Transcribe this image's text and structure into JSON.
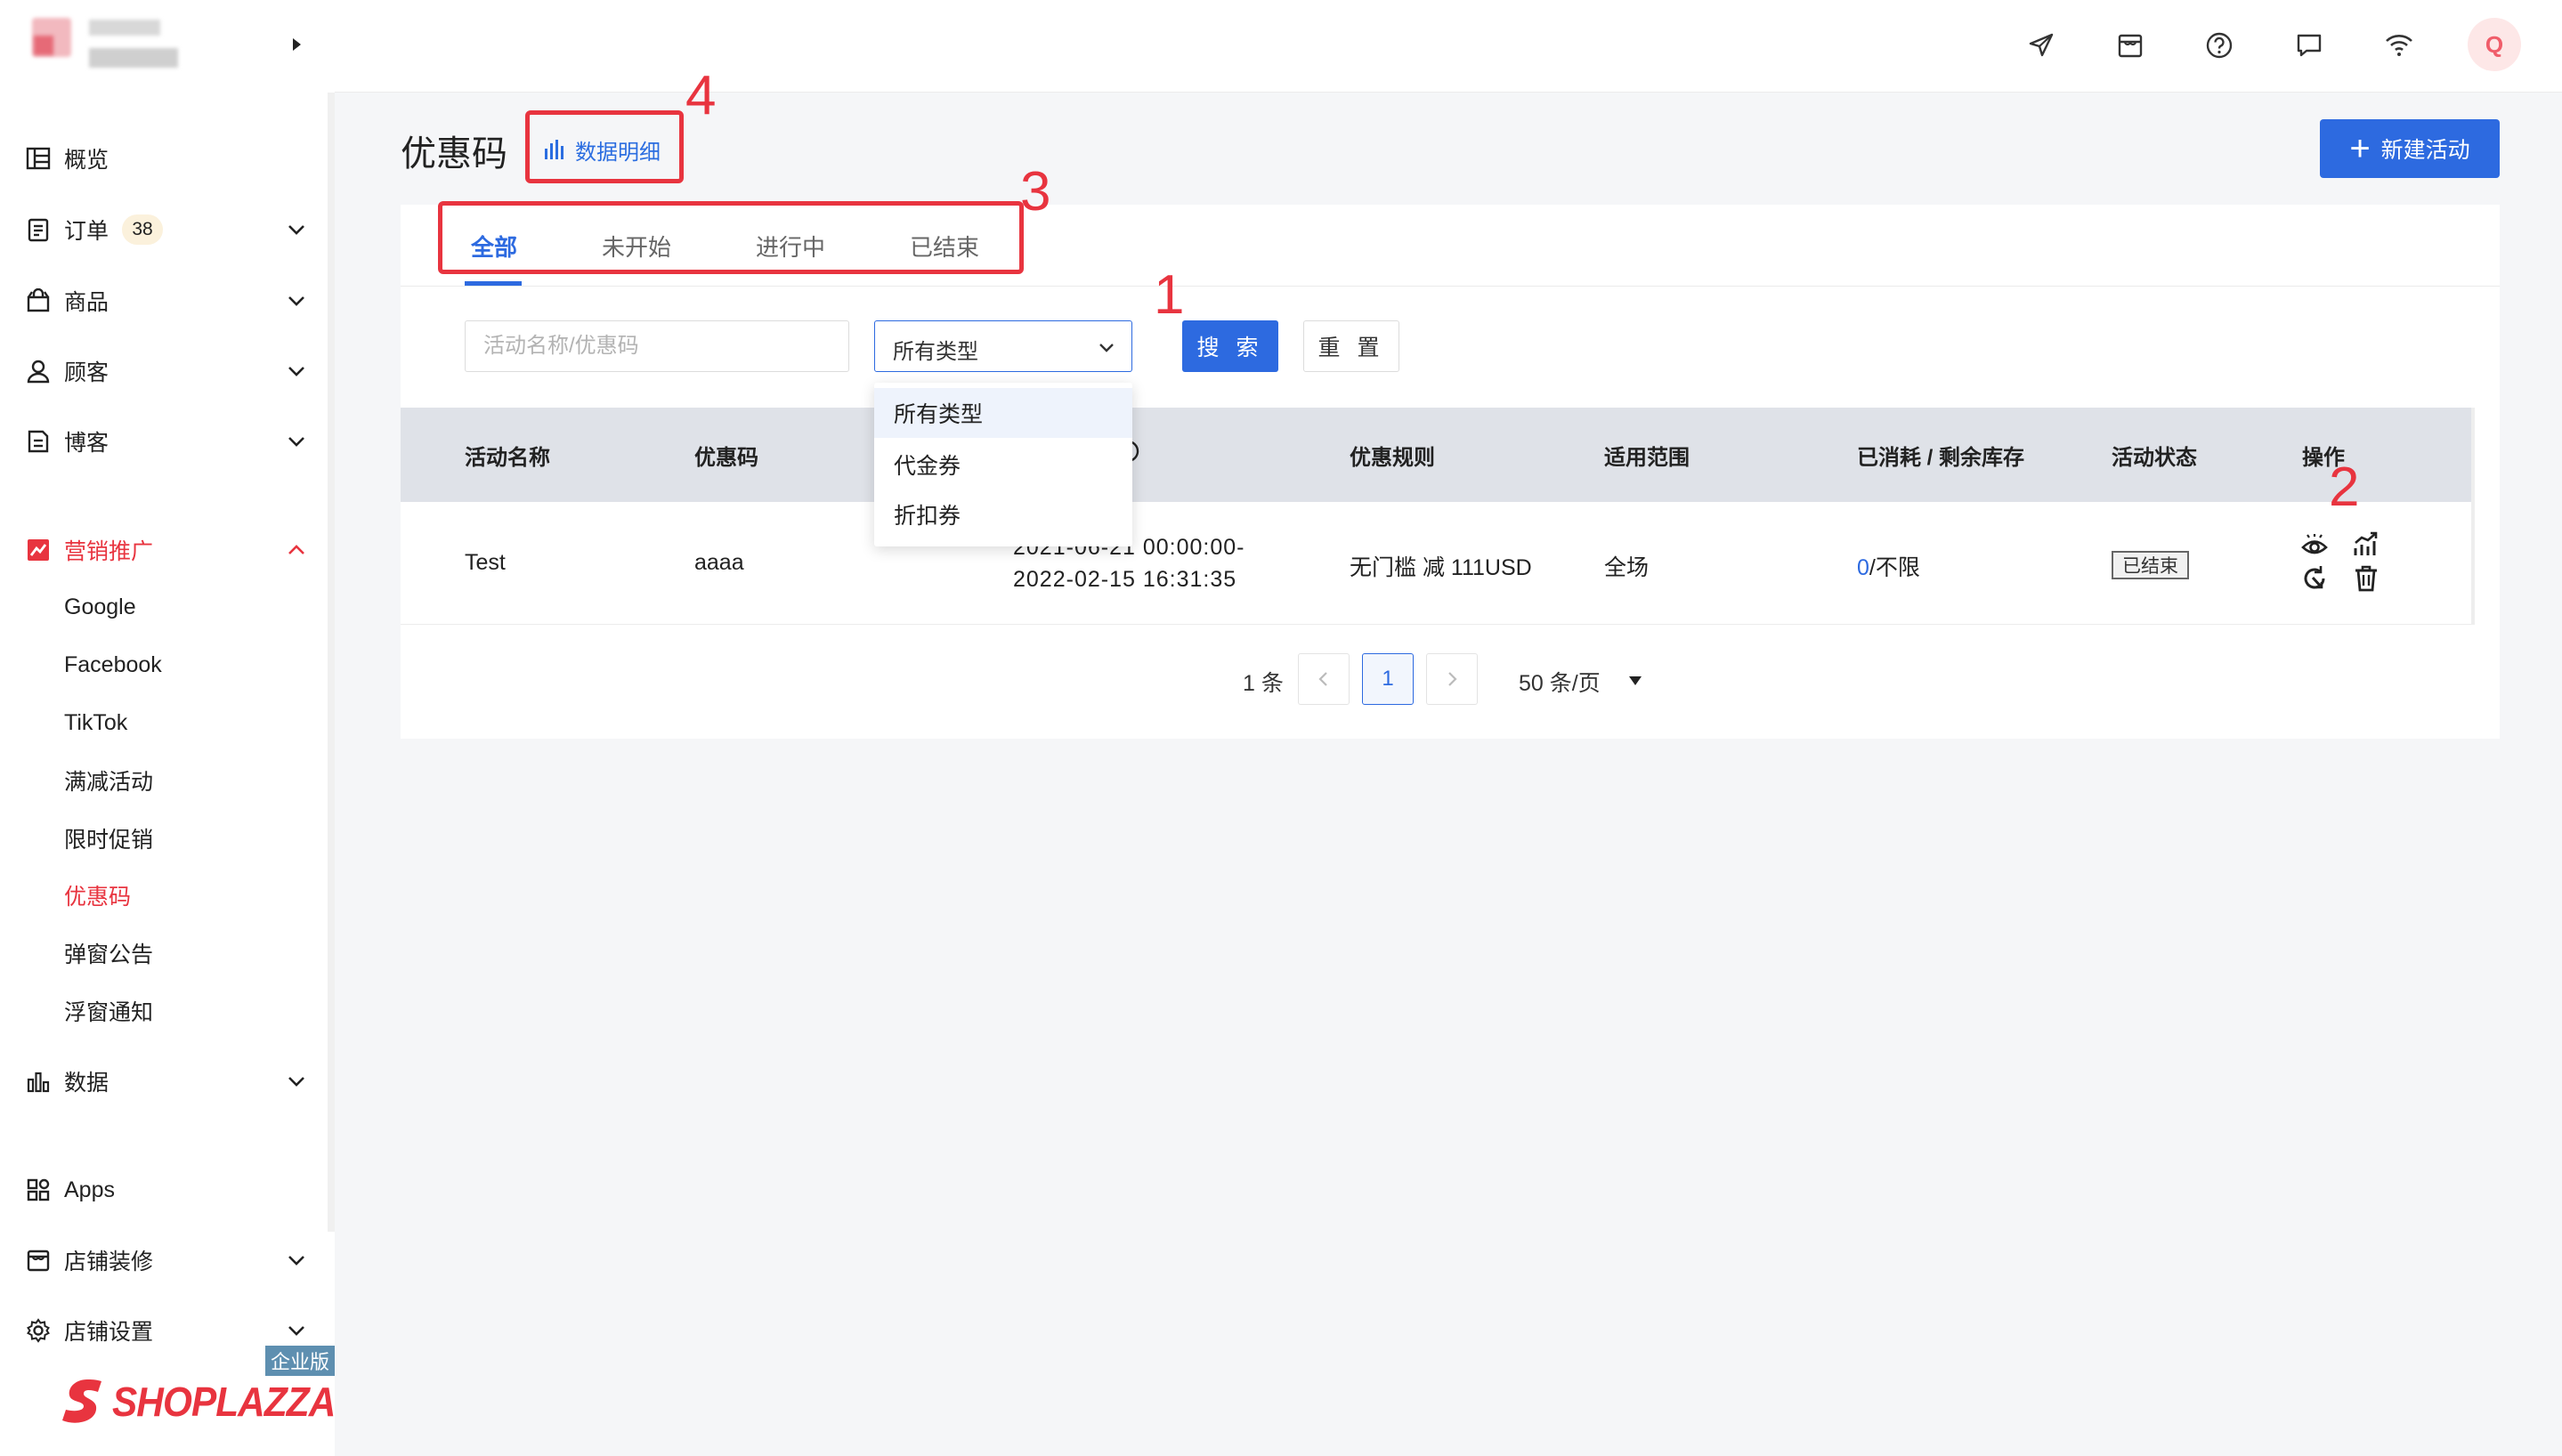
{
  "sidebar": {
    "collapse_icon": "caret-right-icon",
    "items": [
      {
        "label": "概览",
        "icon": "dashboard-icon"
      },
      {
        "label": "订单",
        "icon": "order-icon",
        "badge": "38"
      },
      {
        "label": "商品",
        "icon": "bag-icon"
      },
      {
        "label": "顾客",
        "icon": "user-icon"
      },
      {
        "label": "博客",
        "icon": "blog-icon"
      },
      {
        "label": "营销推广",
        "icon": "marketing-icon"
      },
      {
        "label": "数据",
        "icon": "bar-chart-icon"
      },
      {
        "label": "Apps",
        "icon": "apps-icon"
      },
      {
        "label": "店铺装修",
        "icon": "store-icon"
      },
      {
        "label": "店铺设置",
        "icon": "gear-icon"
      }
    ],
    "marketing_sub": [
      "Google",
      "Facebook",
      "TikTok",
      "满减活动",
      "限时促销",
      "优惠码",
      "弹窗公告",
      "浮窗通知"
    ],
    "active_sub": "优惠码",
    "edition_badge": "企业版",
    "brand": "SHOPLAZZA"
  },
  "topbar": {
    "icons": [
      "send-icon",
      "storefront-icon",
      "help-icon",
      "message-icon",
      "wifi-icon"
    ],
    "avatar_letter": "Q"
  },
  "page": {
    "title": "优惠码",
    "data_detail_link": "数据明细",
    "new_button": "新建活动"
  },
  "tabs": [
    "全部",
    "未开始",
    "进行中",
    "已结束"
  ],
  "active_tab": "全部",
  "filters": {
    "search_placeholder": "活动名称/优惠码",
    "type_value": "所有类型",
    "type_options": [
      "所有类型",
      "代金券",
      "折扣券"
    ],
    "search_button": "搜 索",
    "reset_button": "重 置"
  },
  "table": {
    "columns": [
      "活动名称",
      "优惠码",
      "",
      "优惠规则",
      "适用范围",
      "已消耗 / 剩余库存",
      "活动状态",
      "操作"
    ],
    "rows": [
      {
        "name": "Test",
        "code": "aaaa",
        "time_start": "2021-06-21 00:00:00-",
        "time_end": "2022-02-15 16:31:35",
        "rule": "无门槛 减 111USD",
        "scope": "全场",
        "stock_used": "0",
        "stock_rest": "/不限",
        "status": "已结束",
        "actions": [
          "eye-icon",
          "stats-icon",
          "copy-refresh-icon",
          "trash-icon"
        ]
      }
    ]
  },
  "pagination": {
    "total": "1 条",
    "current_page": "1",
    "page_size": "50 条/页"
  },
  "annotations": {
    "labels": [
      "1",
      "2",
      "3",
      "4"
    ],
    "color": "#e8343f"
  },
  "colors": {
    "primary": "#2d6ae0",
    "accent_red": "#e8343f"
  }
}
